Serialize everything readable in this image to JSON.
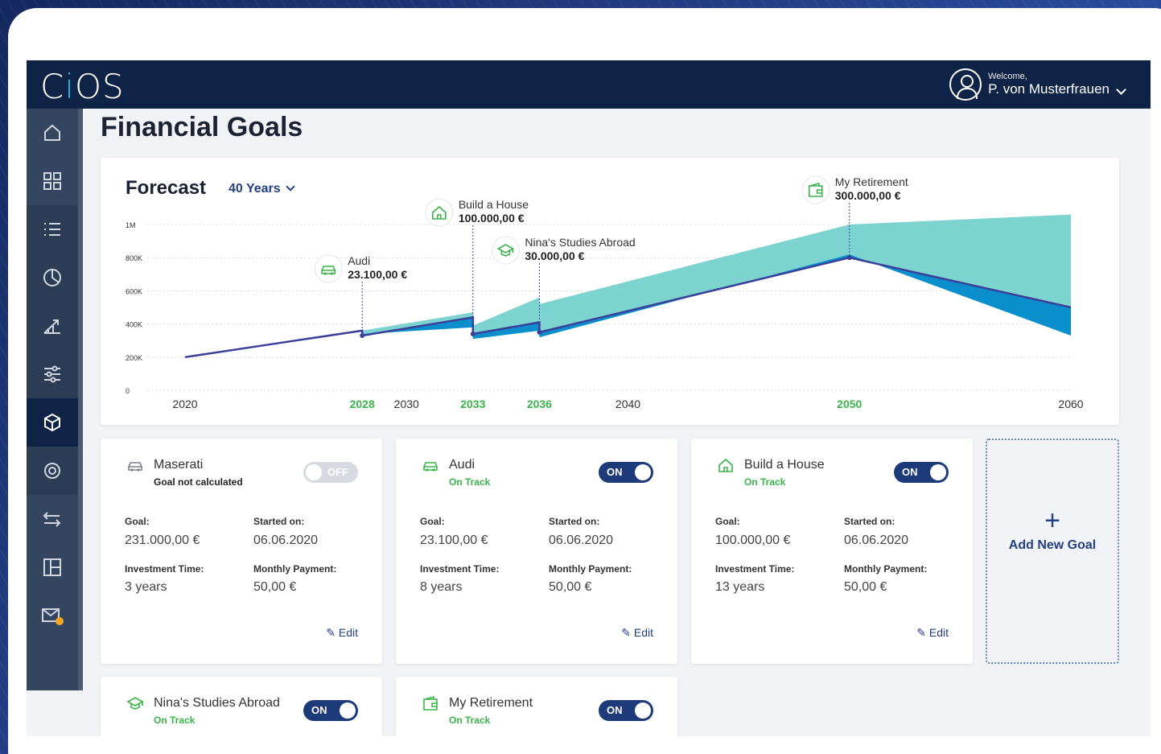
{
  "app": {
    "logo_left": "C",
    "logo_dot": "i",
    "logo_right": "OS"
  },
  "user": {
    "welcome": "Welcome,",
    "name": "P. von Musterfrauen"
  },
  "page": {
    "title": "Financial Goals"
  },
  "forecast": {
    "label": "Forecast",
    "range": "40 Years"
  },
  "sidebar": {
    "items": [
      "home-icon",
      "dashboard-icon",
      "list-icon",
      "pie-chart-icon",
      "growth-chart-icon",
      "sliders-icon",
      "cube-icon",
      "sync-icon",
      "transfer-icon",
      "layout-icon",
      "mail-icon"
    ],
    "active": 6
  },
  "colors": {
    "navy": "#0f2346",
    "accent": "#24407f",
    "green": "#3ab44a",
    "teal": "#7dd3cf",
    "blue": "#0a8fcc",
    "line": "#3a3f99"
  },
  "chart_data": {
    "type": "area",
    "y_ticks": [
      "1M",
      "800K",
      "600K",
      "400K",
      "200K",
      "0"
    ],
    "ylim": [
      0,
      1000000
    ],
    "xlim": [
      2016,
      2065
    ],
    "x_ticks": [
      {
        "label": "2020",
        "x": 2020,
        "highlight": false
      },
      {
        "label": "2028",
        "x": 2028,
        "highlight": true
      },
      {
        "label": "2030",
        "x": 2030,
        "highlight": false
      },
      {
        "label": "2033",
        "x": 2033,
        "highlight": true
      },
      {
        "label": "2036",
        "x": 2036,
        "highlight": true
      },
      {
        "label": "2040",
        "x": 2040,
        "highlight": false
      },
      {
        "label": "2050",
        "x": 2050,
        "highlight": true
      },
      {
        "label": "2060",
        "x": 2060,
        "highlight": false
      }
    ],
    "line": [
      [
        2020,
        200000
      ],
      [
        2024,
        280000
      ],
      [
        2028,
        360000
      ],
      [
        2028,
        330000
      ],
      [
        2033,
        440000
      ],
      [
        2033,
        340000
      ],
      [
        2036,
        410000
      ],
      [
        2036,
        350000
      ],
      [
        2050,
        800000
      ],
      [
        2060,
        500000
      ]
    ],
    "upper": [
      [
        2028,
        360000
      ],
      [
        2033,
        470000
      ],
      [
        2033,
        390000
      ],
      [
        2036,
        560000
      ],
      [
        2036,
        520000
      ],
      [
        2050,
        1000000
      ],
      [
        2060,
        1060000
      ]
    ],
    "lower": [
      [
        2028,
        340000
      ],
      [
        2033,
        380000
      ],
      [
        2033,
        310000
      ],
      [
        2036,
        360000
      ],
      [
        2036,
        320000
      ],
      [
        2050,
        820000
      ],
      [
        2060,
        330000
      ]
    ],
    "milestones": [
      {
        "name": "Audi",
        "amount": "23.100,00 €",
        "x": 2028,
        "icon": "car-icon"
      },
      {
        "name": "Build a House",
        "amount": "100.000,00 €",
        "x": 2033,
        "icon": "house-icon"
      },
      {
        "name": "Nina's Studies Abroad",
        "amount": "30.000,00 €",
        "x": 2036,
        "icon": "graduation-cap-icon"
      },
      {
        "name": "My Retirement",
        "amount": "300.000,00 €",
        "x": 2050,
        "icon": "wallet-icon"
      }
    ]
  },
  "labels": {
    "goal": "Goal:",
    "started": "Started on:",
    "investment_time": "Investment Time:",
    "monthly_payment": "Monthly Payment:",
    "edit": "Edit",
    "add_new_goal": "Add New Goal"
  },
  "cards": [
    {
      "name": "Maserati",
      "status": "Goal not calculated",
      "toggle": "OFF",
      "goal": "231.000,00 €",
      "started": "06.06.2020",
      "time": "3 years",
      "payment": "50,00 €"
    },
    {
      "name": "Audi",
      "status": "On Track",
      "toggle": "ON",
      "goal": "23.100,00 €",
      "started": "06.06.2020",
      "time": "8 years",
      "payment": "50,00 €"
    },
    {
      "name": "Build a House",
      "status": "On Track",
      "toggle": "ON",
      "goal": "100.000,00 €",
      "started": "06.06.2020",
      "time": "13 years",
      "payment": "50,00 €"
    }
  ],
  "cards_bottom": [
    {
      "name": "Nina's Studies Abroad",
      "status": "On Track",
      "toggle": "ON"
    },
    {
      "name": "My Retirement",
      "status": "On Track",
      "toggle": "ON"
    }
  ]
}
